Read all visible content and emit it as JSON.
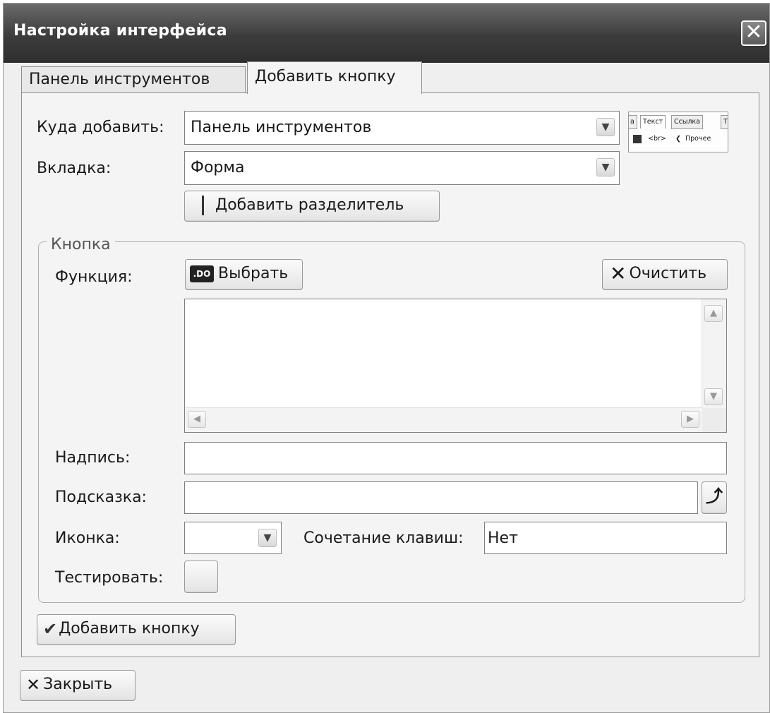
{
  "window": {
    "title": "Настройка интерфейса",
    "close_glyph": "✕"
  },
  "tabs": [
    {
      "label": "Панель инструментов",
      "active": false
    },
    {
      "label": "Добавить кнопку",
      "active": true
    }
  ],
  "form": {
    "where_label": "Куда добавить:",
    "where_value": "Панель инструментов",
    "tab_label": "Вкладка:",
    "tab_value": "Форма",
    "add_separator_label": "Добавить разделитель"
  },
  "preview": {
    "tabs": [
      "а",
      "Текст",
      "Ссылка",
      "Т"
    ],
    "row": [
      "<br>",
      "Прочее"
    ]
  },
  "button_group": {
    "legend": "Кнопка",
    "function_label": "Функция:",
    "choose_label": "Выбрать",
    "choose_icon_text": ".DO",
    "clear_label": "Очистить",
    "function_code": "",
    "caption_label": "Надпись:",
    "caption_value": "",
    "hint_label": "Подсказка:",
    "hint_value": "",
    "icon_label": "Иконка:",
    "hotkey_label": "Сочетание клавиш:",
    "hotkey_value": "Нет",
    "test_label": "Тестировать:"
  },
  "actions": {
    "add_button_label": "Добавить кнопку",
    "close_label": "Закрыть"
  },
  "colors": {
    "titlebar": "#3c3c3c",
    "dialog_bg": "#efefef",
    "panel_bg": "#f4f4f4"
  }
}
